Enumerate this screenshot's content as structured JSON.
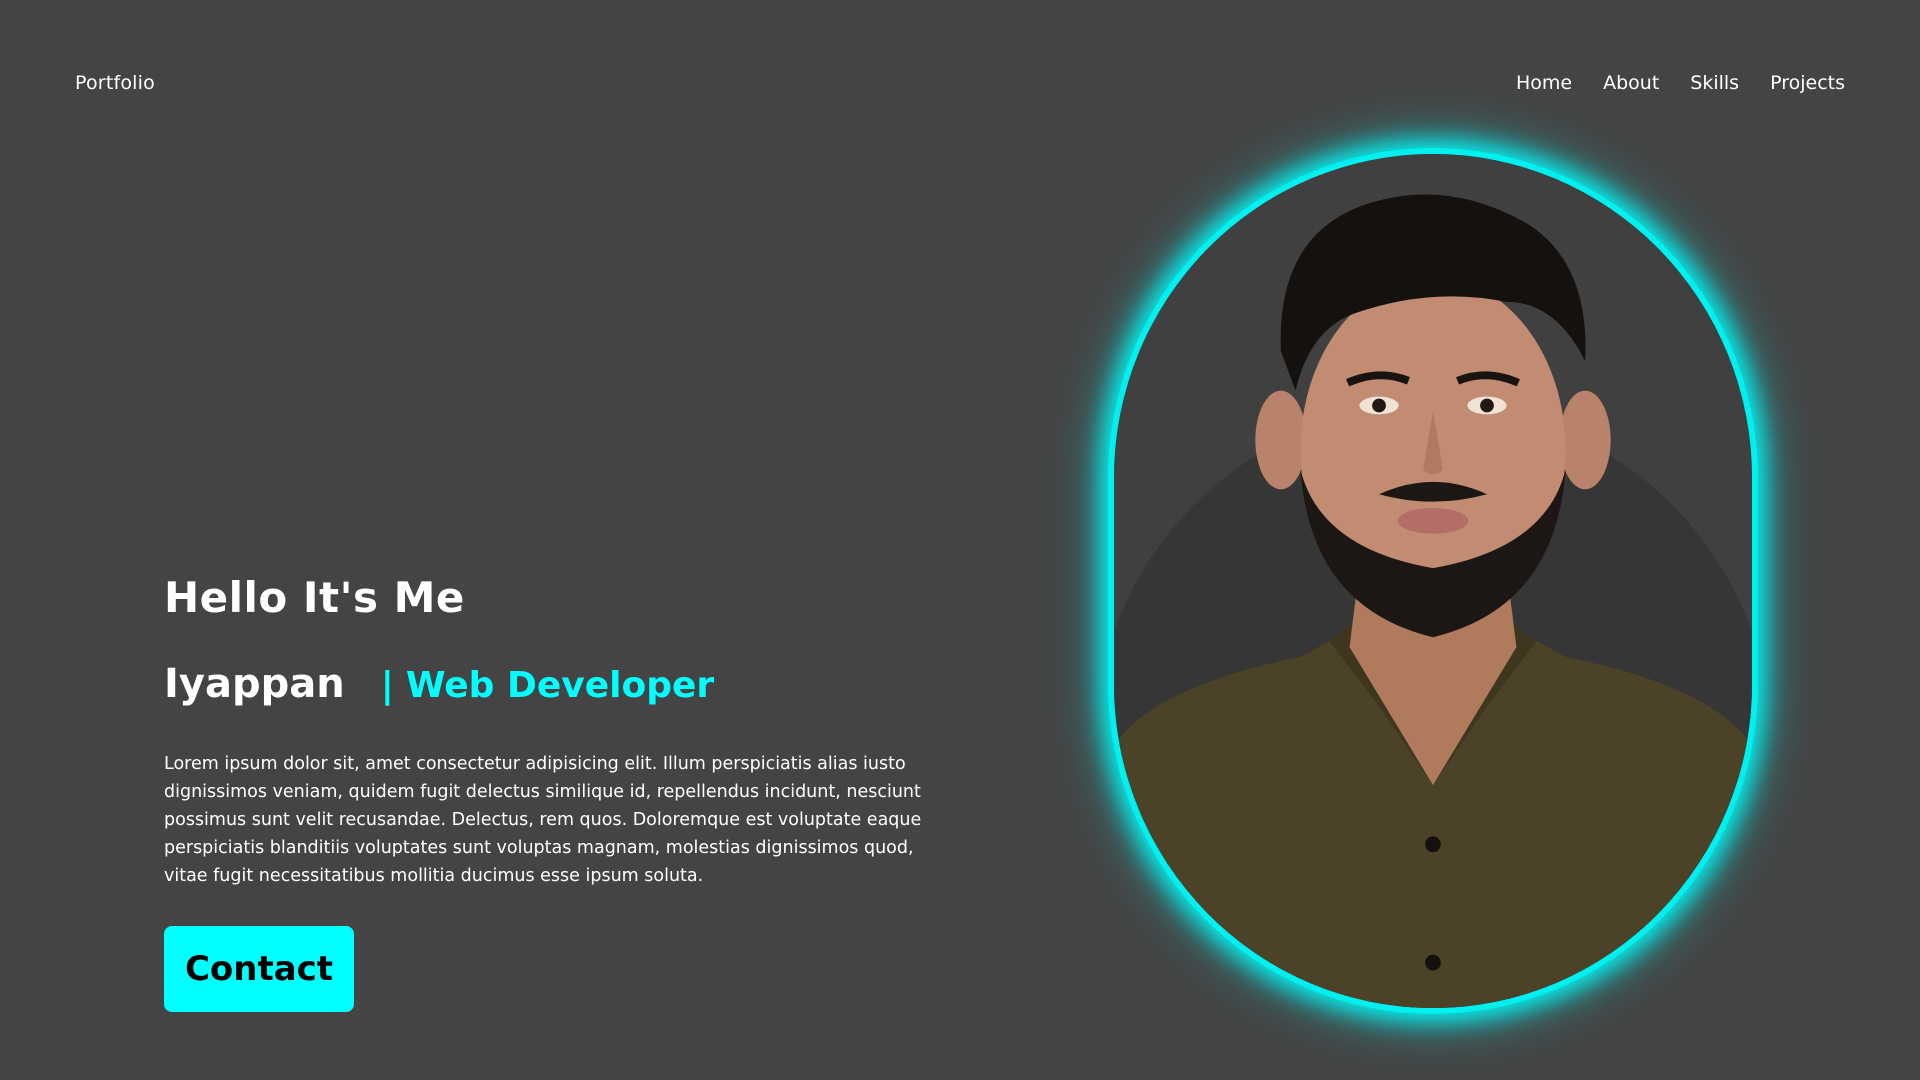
{
  "header": {
    "logo": "Portfolio",
    "nav": [
      {
        "label": "Home"
      },
      {
        "label": "About"
      },
      {
        "label": "Skills"
      },
      {
        "label": "Projects"
      }
    ]
  },
  "hero": {
    "greeting": "Hello It's Me",
    "name": "Iyappan",
    "role_bar": "|",
    "role": "Web Developer",
    "description": "Lorem ipsum dolor sit, amet consectetur adipisicing elit. Illum perspiciatis alias iusto dignissimos veniam, quidem fugit delectus similique id, repellendus incidunt, nesciunt possimus sunt velit recusandae. Delectus, rem quos. Doloremque est voluptate eaque perspiciatis blanditiis voluptates sunt voluptas magnam, molestias dignissimos quod, vitae fugit necessitatibus mollitia ducimus esse ipsum soluta.",
    "contact_label": "Contact"
  },
  "colors": {
    "background": "#444444",
    "accent": "#00ffff",
    "text": "#ffffff"
  }
}
